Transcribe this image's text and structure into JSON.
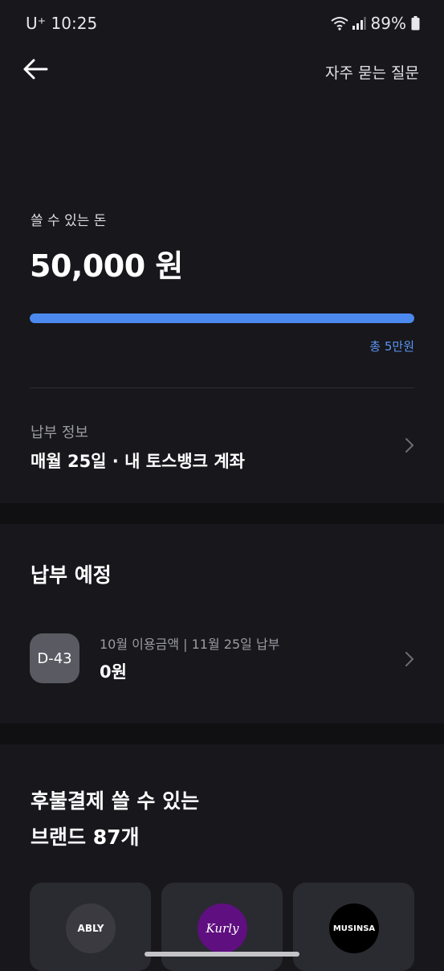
{
  "status": {
    "carrier": "U⁺ 10:25",
    "battery": "89%"
  },
  "header": {
    "faq_label": "자주 묻는 질문"
  },
  "balance": {
    "label": "쓸 수 있는 돈",
    "amount": "50,000 원",
    "progress_fraction": 1.0,
    "total_label": "총 5만원"
  },
  "pay_info": {
    "label": "납부 정보",
    "value": "매월 25일 · 내 토스뱅크 계좌"
  },
  "upcoming": {
    "title": "납부 예정",
    "badge": "D-43",
    "subtitle": "10월 이용금액 | 11월 25일 납부",
    "amount": "0원"
  },
  "brands": {
    "title_line1": "후불결제 쓸 수 있는",
    "title_line2": "브랜드 87개",
    "items": [
      {
        "name": "ABLY",
        "color": "#3a3a40"
      },
      {
        "name": "Kurly",
        "color": "#5f0f80"
      },
      {
        "name": "MUSINSA",
        "color": "#000000"
      }
    ]
  },
  "colors": {
    "accent": "#4c89ee",
    "background": "#17171c"
  }
}
